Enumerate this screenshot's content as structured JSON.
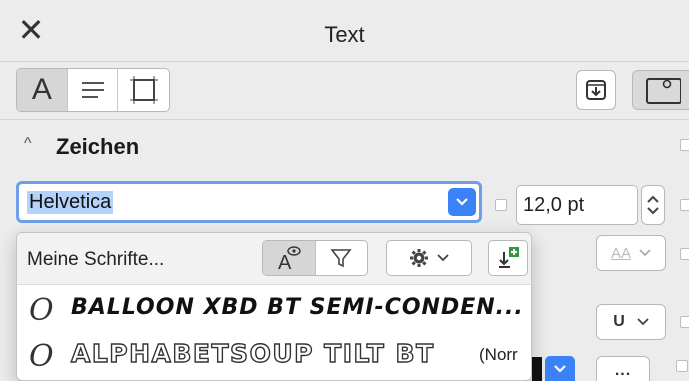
{
  "window": {
    "title": "Text",
    "close_icon": "close-icon"
  },
  "toolbar": {
    "tabs": [
      {
        "id": "character",
        "label": "A",
        "icon": "character-icon",
        "active": true
      },
      {
        "id": "paragraph",
        "label": "",
        "icon": "paragraph-lines-icon",
        "active": false
      },
      {
        "id": "frame",
        "label": "",
        "icon": "frame-icon",
        "active": false
      }
    ],
    "right_buttons": [
      "import-icon",
      "preview-frame-icon"
    ]
  },
  "section": {
    "title": "Zeichen",
    "collapse_icon": "chevron-up-icon"
  },
  "font": {
    "value": "Helvetica"
  },
  "size": {
    "value": "12,0 pt"
  },
  "font_list": {
    "filter_label": "Meine Schrifte...",
    "rows": [
      {
        "name": "BALLOON XBD BT SEMI-CONDEN...",
        "style": "",
        "icon": "font-o-icon"
      },
      {
        "name": "ALPHABETSOUP TILT BT",
        "style": "(Norr",
        "icon": "font-o-icon"
      }
    ]
  },
  "right_controls": {
    "case_label": "AA",
    "underline_label": "U",
    "more_label": "..."
  },
  "colors": {
    "accent": "#3b82f6",
    "focus_ring": "#6e9ee8",
    "selection": "#b3d3fb"
  }
}
